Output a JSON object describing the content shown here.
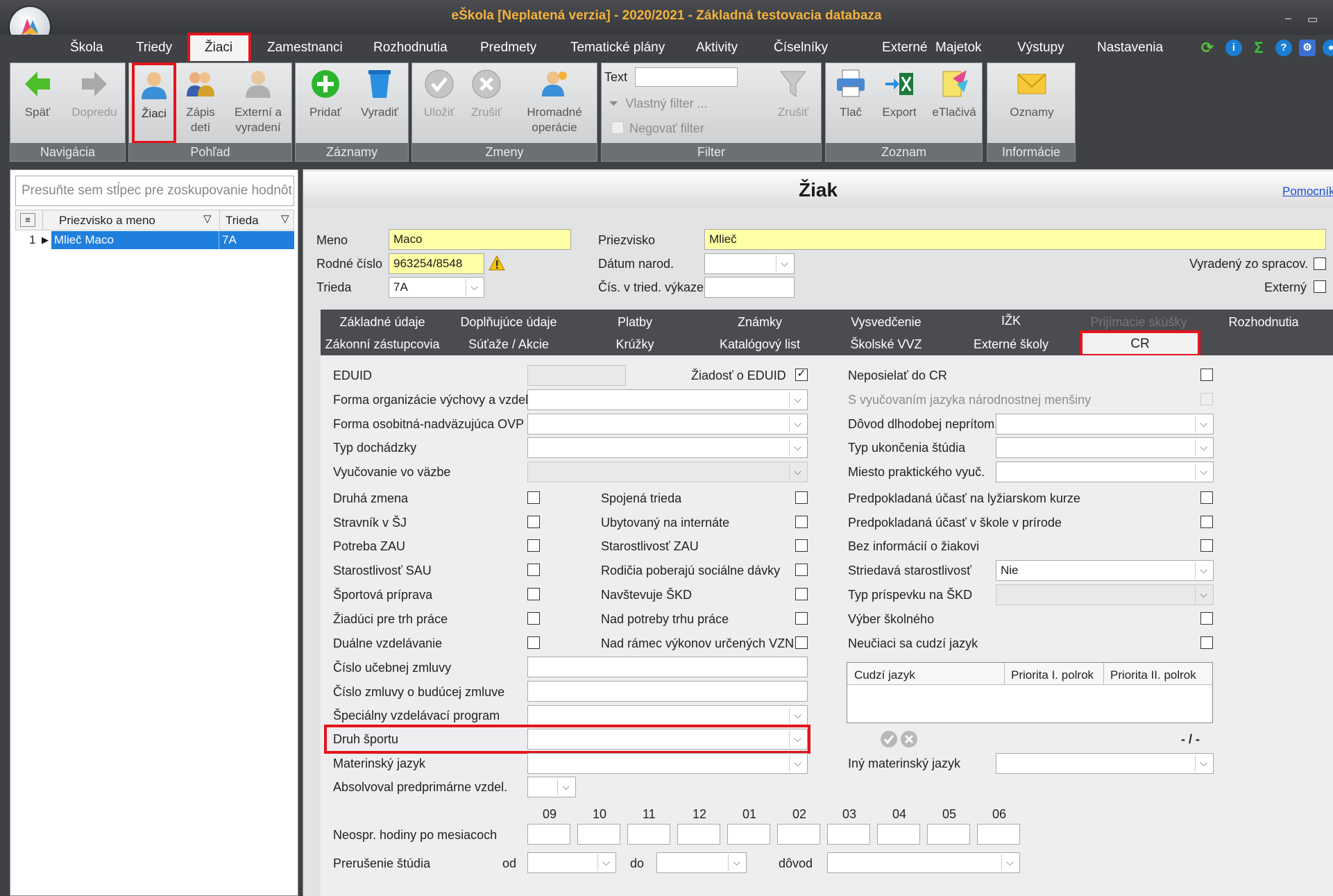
{
  "window": {
    "title": "eŠkola [Neplatená verzia] - 2020/2021 - Základná testovacia databaza"
  },
  "menu": [
    "Škola",
    "Triedy",
    "Žiaci",
    "Zamestnanci",
    "Rozhodnutia",
    "Predmety",
    "Tematické plány",
    "Aktivity",
    "Číselníky",
    "Externé",
    "Majetok",
    "Výstupy",
    "Nastavenia"
  ],
  "ribbon": {
    "navigacia": {
      "label": "Navigácia",
      "back": "Späť",
      "forward": "Dopredu"
    },
    "pohlad": {
      "label": "Pohľad",
      "ziaci": "Žiaci",
      "zapis1": "Zápis",
      "zapis2": "detí",
      "ext1": "Externí a",
      "ext2": "vyradení"
    },
    "zaznamy": {
      "label": "Záznamy",
      "add": "Pridať",
      "remove": "Vyradiť"
    },
    "zmeny": {
      "label": "Zmeny",
      "save": "Uložiť",
      "cancel": "Zrušiť",
      "bulk1": "Hromadné",
      "bulk2": "operácie"
    },
    "filter": {
      "label": "Filter",
      "text": "Text",
      "custom": "Vlastný filter ...",
      "negate": "Negovať filter",
      "clear": "Zrušiť"
    },
    "zoznam": {
      "label": "Zoznam",
      "print": "Tlač",
      "export": "Export",
      "eprint": "eTlačivá"
    },
    "informacie": {
      "label": "Informácie",
      "notices": "Oznamy"
    }
  },
  "left": {
    "group_placeholder": "Presuňte sem stĺpec pre zoskupovanie hodnôt",
    "columns": [
      "Priezvisko a meno",
      "Trieda"
    ],
    "rows": [
      {
        "num": "1",
        "name": "Mlieč Maco",
        "class": "7A"
      }
    ]
  },
  "form": {
    "title": "Žiak",
    "help": "Pomocník",
    "meno_lbl": "Meno",
    "meno": "Maco",
    "priezvisko_lbl": "Priezvisko",
    "priezvisko": "Mlieč",
    "rc_lbl": "Rodné číslo",
    "rc": "963254/8548",
    "datum_lbl": "Dátum narod.",
    "vyradeny_lbl": "Vyradený zo spracov.",
    "trieda_lbl": "Trieda",
    "trieda": "7A",
    "cis_lbl": "Čís. v tried. výkaze",
    "externy_lbl": "Externý"
  },
  "tabs": {
    "row1": [
      "Základné údaje",
      "Doplňujúce údaje",
      "Platby",
      "Známky",
      "Vysvedčenie",
      "IŽK",
      "Prijímacie skúšky",
      "Rozhodnutia"
    ],
    "row2": [
      "Zákonní zástupcovia",
      "Súťaže / Akcie",
      "Krúžky",
      "Katalógový list",
      "Školské VVZ",
      "Externé školy",
      "CR"
    ]
  },
  "cr": {
    "eduid": "EDUID",
    "ziadost": "Žiadosť o EDUID",
    "neposielat": "Neposielať do CR",
    "forma_org": "Forma organizácie výchovy a vzdel.",
    "s_vyuc": "S vyučovaním jazyka národnostnej menšiny",
    "forma_osob": "Forma osobitná-nadväzujúca OVP",
    "dovod": "Dôvod dlhodobej neprítom.",
    "typ_doch": "Typ dochádzky",
    "typ_ukon": "Typ ukončenia štúdia",
    "vyuc_vazbe": "Vyučovanie vo väzbe",
    "miesto": "Miesto praktického vyuč.",
    "col1": [
      "Druhá zmena",
      "Stravník v ŠJ",
      "Potreba ZAU",
      "Starostlivosť SAU",
      "Športová príprava",
      "Žiadúci pre trh práce",
      "Duálne vzdelávanie"
    ],
    "col2": [
      "Spojená trieda",
      "Ubytovaný na internáte",
      "Starostlivosť ZAU",
      "Rodičia poberajú sociálne dávky",
      "Navštevuje ŠKD",
      "Nad potreby trhu práce",
      "Nad rámec výkonov určených VZN"
    ],
    "col3": [
      "Predpokladaná účasť na lyžiarskom kurze",
      "Predpokladaná účasť v škole v prírode",
      "Bez informácií o žiakovi",
      "Striedavá starostlivosť",
      "Typ príspevku na ŠKD",
      "Výber školného",
      "Neučiaci sa cudzí jazyk"
    ],
    "striedava_val": "Nie",
    "cislo_ucebnej": "Číslo učebnej zmluvy",
    "cislo_zmluvy": "Číslo zmluvy o budúcej zmluve",
    "special": "Špeciálny vzdelávací program",
    "druh_sportu": "Druh športu",
    "materinsky": "Materinský jazyk",
    "absolvoval": "Absolvoval predprimárne vzdel.",
    "iny_mat": "Iný materinský jazyk",
    "lang_cols": [
      "Cudzí jazyk",
      "Priorita I. polrok",
      "Priorita II. polrok"
    ],
    "pager": "- / -",
    "months": [
      "09",
      "10",
      "11",
      "12",
      "01",
      "02",
      "03",
      "04",
      "05",
      "06"
    ],
    "neospr": "Neospr. hodiny po mesiacoch",
    "prerusenie": "Prerušenie štúdia",
    "od": "od",
    "do": "do",
    "dovod_short": "dôvod"
  }
}
